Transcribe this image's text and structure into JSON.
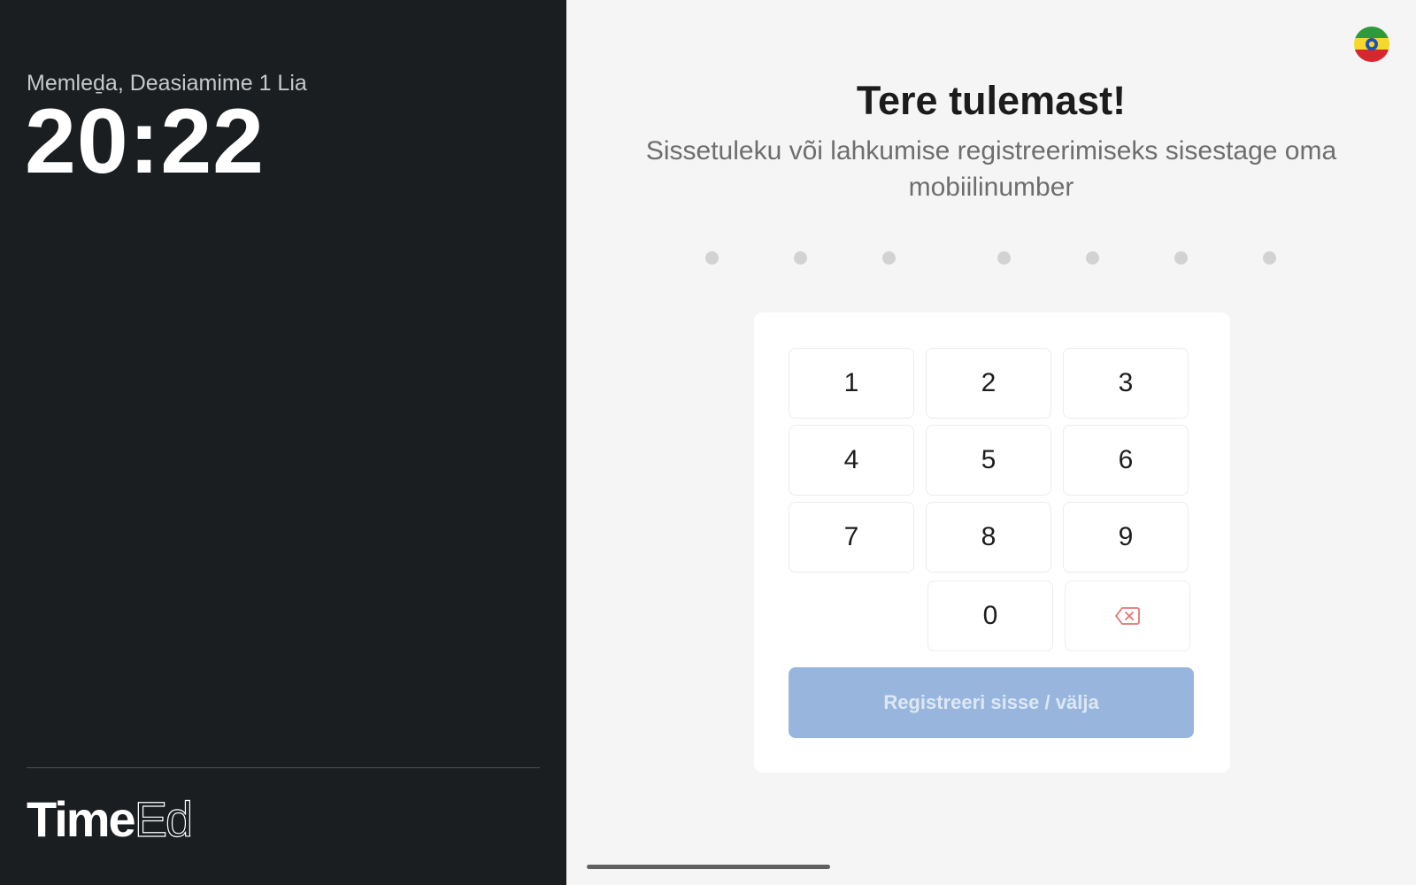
{
  "sidebar": {
    "date": "Memleḏa, Deasiamime 1 Lia",
    "time": "20:22",
    "logo_bold": "Time",
    "logo_light": "Ed"
  },
  "main": {
    "language_flag_icon": "flag-icon",
    "title": "Tere tulemast!",
    "subtitle": "Sissetuleku või lahkumise registreerimiseks sisestage oma mobiilinumber",
    "pin_dots_count": 7,
    "keys": {
      "k1": "1",
      "k2": "2",
      "k3": "3",
      "k4": "4",
      "k5": "5",
      "k6": "6",
      "k7": "7",
      "k8": "8",
      "k9": "9",
      "k0": "0"
    },
    "backspace_icon": "backspace-icon",
    "submit_label": "Registreeri sisse / välja"
  },
  "colors": {
    "sidebar_bg": "#1b1e21",
    "main_bg": "#f5f5f5",
    "submit_bg": "#98b6dd",
    "backspace_accent": "#e57373"
  }
}
